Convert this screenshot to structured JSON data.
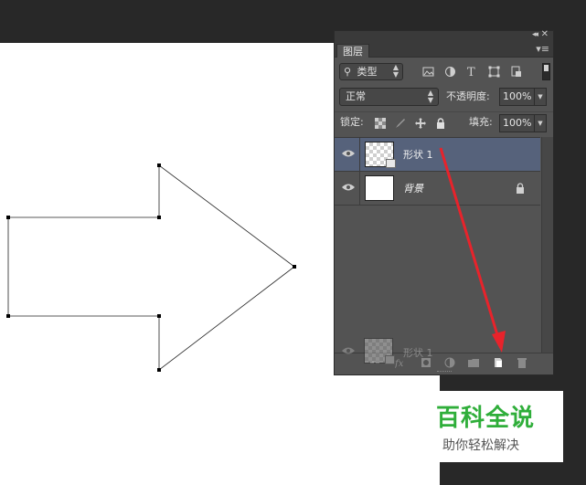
{
  "panel": {
    "tab_label": "图层",
    "collapse_glyph": "◂◂",
    "close_glyph": "✕",
    "menu_glyph": "≡",
    "filter": {
      "label": "类型",
      "search_glyph": "⚲"
    },
    "blend_mode": "正常",
    "opacity_label": "不透明度:",
    "opacity_value": "100%",
    "lock_label": "锁定:",
    "fill_label": "填充:",
    "fill_value": "100%"
  },
  "layers": [
    {
      "name": "形状 1",
      "selected": true,
      "thumb": "checker"
    },
    {
      "name": "背景",
      "selected": false,
      "thumb": "white",
      "locked": true
    }
  ],
  "drag_ghost": {
    "name": "形状 1"
  },
  "watermark": {
    "title": "百科全说",
    "subtitle": "助你轻松解决"
  },
  "colors": {
    "accent_red": "#e8232b",
    "selected_layer": "#56627b",
    "watermark_green": "#2fae3a"
  }
}
